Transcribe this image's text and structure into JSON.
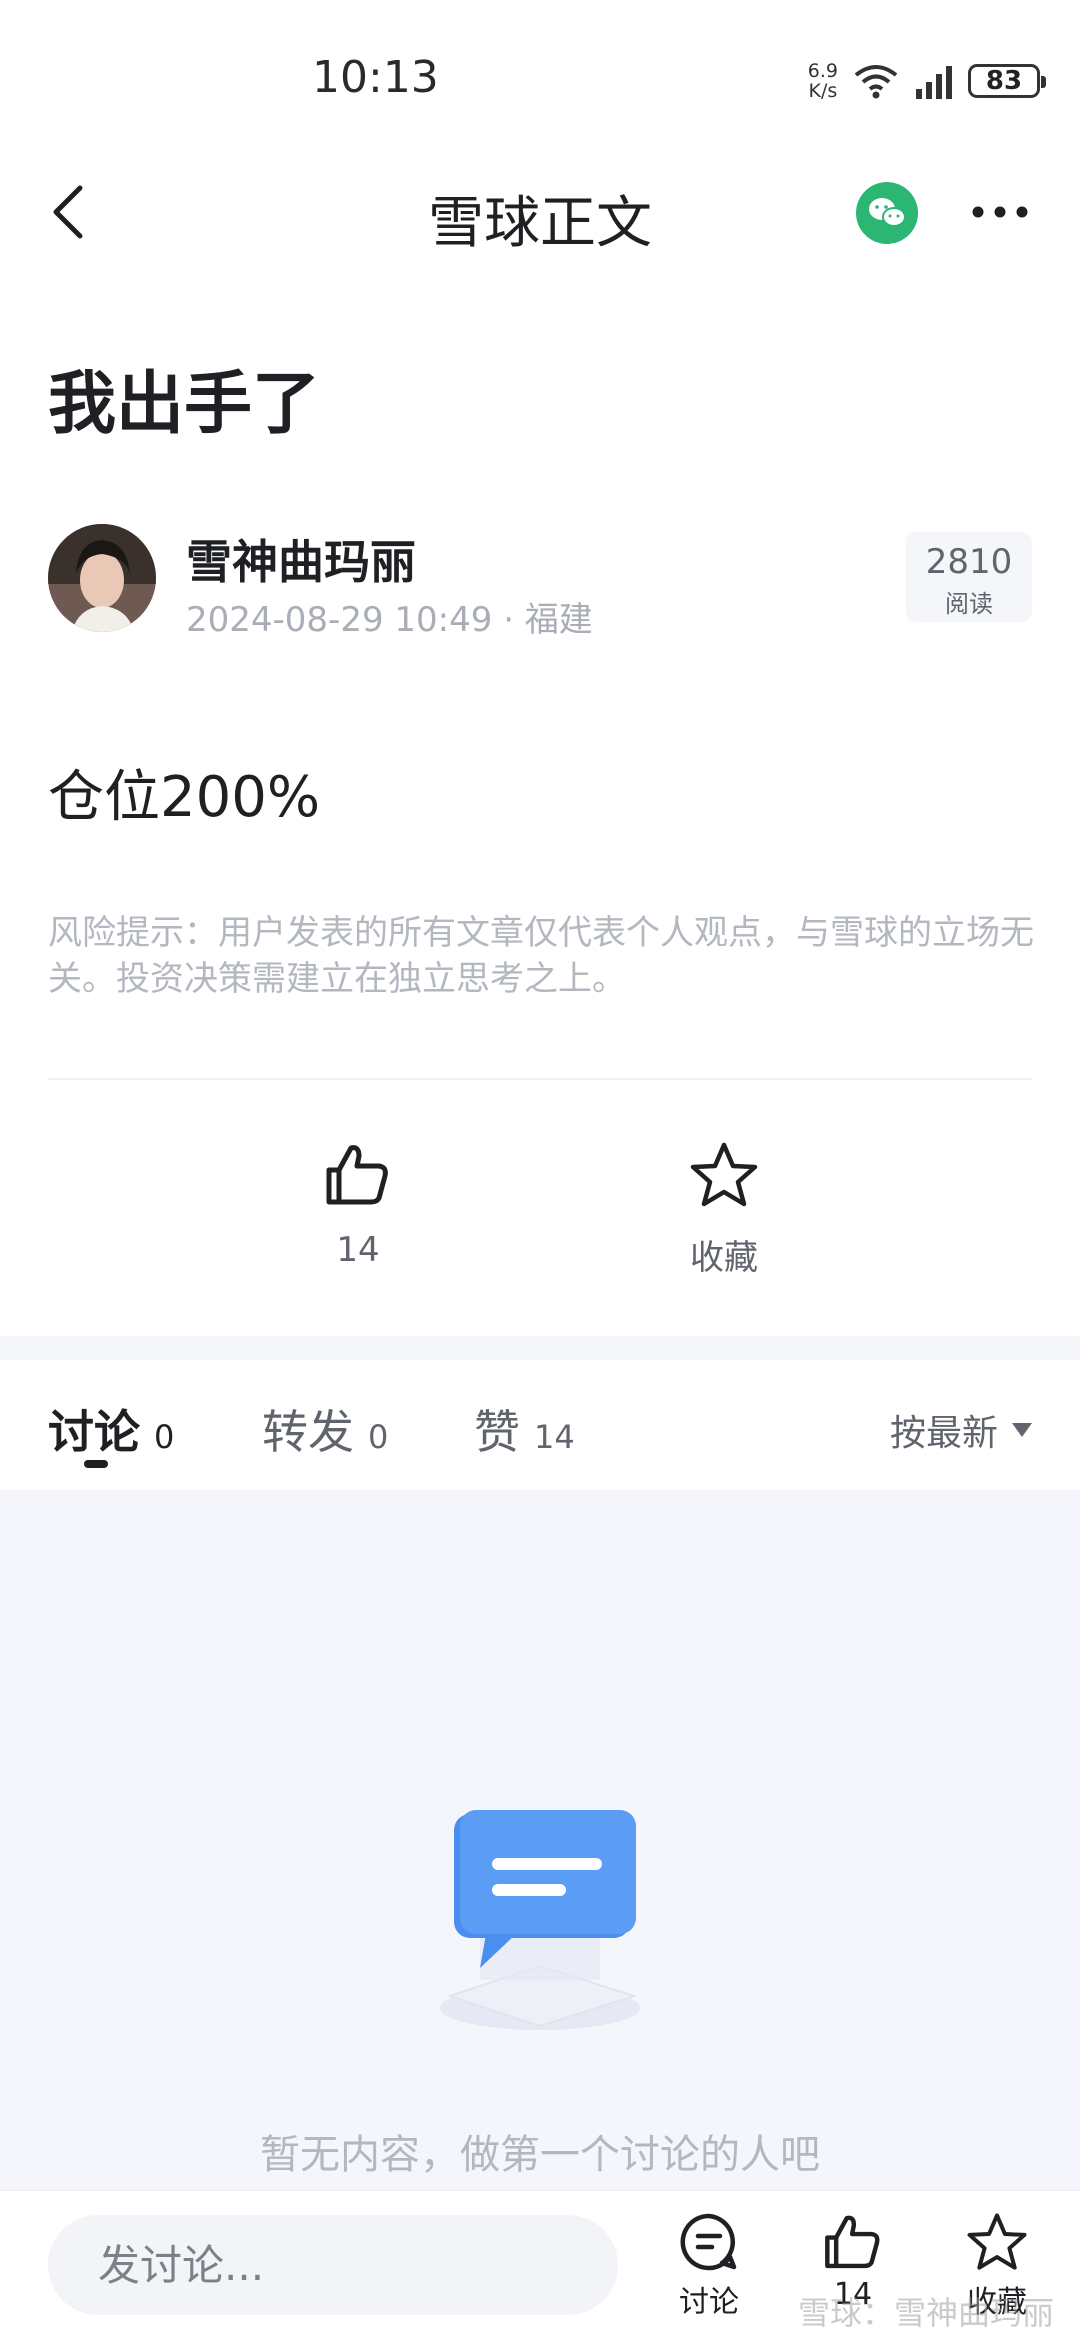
{
  "status_bar": {
    "time": "10:13",
    "net_speed_value": "6.9",
    "net_speed_unit": "K/s",
    "battery": "83"
  },
  "nav": {
    "title": "雪球正文"
  },
  "post": {
    "title": "我出手了",
    "author": "雪神曲玛丽",
    "meta": "2024-08-29 10:49 · 福建",
    "read_count": "2810",
    "read_label": "阅读",
    "body": "仓位200%",
    "risk_note": "风险提示：用户发表的所有文章仅代表个人观点，与雪球的立场无关。投资决策需建立在独立思考之上。"
  },
  "actions": {
    "like_count": "14",
    "favorite_label": "收藏"
  },
  "tabs": [
    {
      "label": "讨论",
      "count": "0"
    },
    {
      "label": "转发",
      "count": "0"
    },
    {
      "label": "赞",
      "count": "14"
    }
  ],
  "sort": {
    "label": "按最新"
  },
  "empty_state": {
    "text": "暂无内容，做第一个讨论的人吧"
  },
  "bottom_bar": {
    "input_placeholder": "发讨论...",
    "discuss_label": "讨论",
    "like_label": "14",
    "favorite_label": "收藏"
  },
  "watermark": "雪球：雪神曲玛丽",
  "colors": {
    "wechat_green": "#2bb673",
    "text_primary": "#1e2024",
    "text_muted": "#b3b7bf",
    "empty_bubble_blue": "#4a8ff0"
  }
}
